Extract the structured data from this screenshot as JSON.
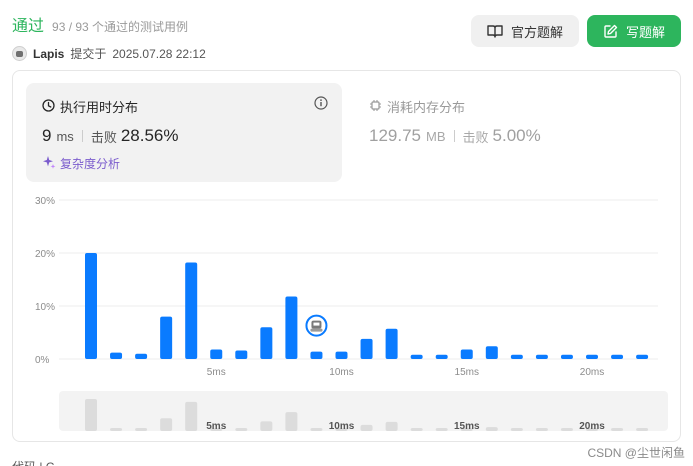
{
  "header": {
    "status": "通过",
    "count": "93 / 93 个通过的测试用例",
    "user": "Lapis",
    "submitted_label": "提交于",
    "submitted_time": "2025.07.28 22:12"
  },
  "buttons": {
    "solution_label": "官方题解",
    "write_label": "写题解"
  },
  "runtime": {
    "title": "执行用时分布",
    "value": "9",
    "unit": "ms",
    "beat_label": "击败",
    "beat_pct": "28.56%",
    "complexity_label": "复杂度分析"
  },
  "memory": {
    "title": "消耗内存分布",
    "value": "129.75",
    "unit": "MB",
    "beat_label": "击败",
    "beat_pct": "5.00%"
  },
  "chart_data": {
    "type": "bar",
    "x": [
      1,
      2,
      3,
      4,
      5,
      6,
      7,
      8,
      9,
      10,
      11,
      12,
      13,
      14,
      15,
      16,
      17,
      18,
      19,
      20,
      21,
      22,
      23
    ],
    "values": [
      20,
      1.2,
      1,
      8,
      18.2,
      1.8,
      1.6,
      6,
      11.8,
      1.4,
      1.4,
      3.8,
      5.7,
      0.8,
      0.8,
      1.8,
      2.4,
      0.8,
      0.8,
      0.8,
      0.8,
      0.8,
      0.8
    ],
    "y_tick_labels": [
      "0%",
      "10%",
      "20%",
      "30%"
    ],
    "y_ticks": [
      0,
      10,
      20,
      30
    ],
    "x_tick_labels": [
      "5ms",
      "10ms",
      "15ms",
      "20ms"
    ],
    "x_ticks": [
      6,
      11,
      16,
      21
    ],
    "ylim": [
      0,
      30
    ],
    "highlight_x": 10,
    "bar_color": "#0a7bff",
    "overview_color": "#dcdcdc",
    "grid": true
  },
  "footer": {
    "cut_text": "代码 | C",
    "watermark": "CSDN @尘世闲鱼"
  }
}
